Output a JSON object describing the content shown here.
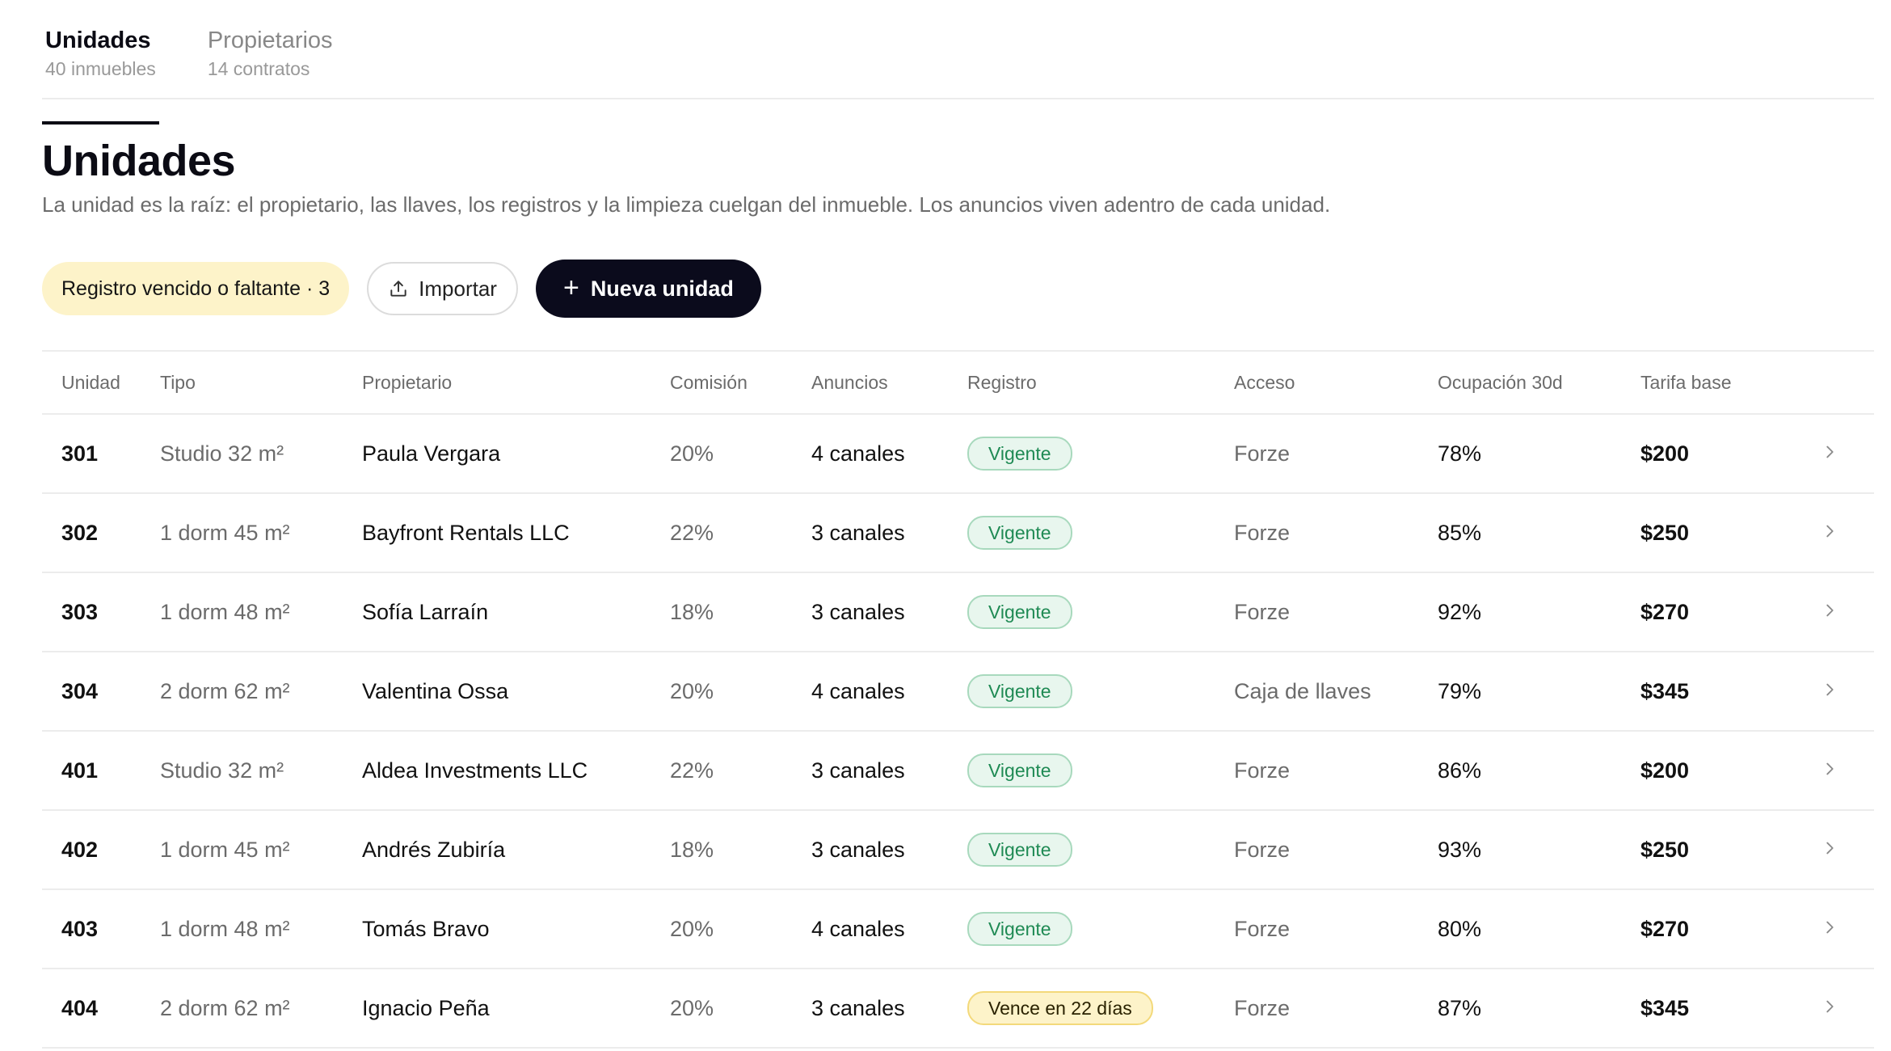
{
  "tabs": [
    {
      "label": "Unidades",
      "sub": "40 inmuebles"
    },
    {
      "label": "Propietarios",
      "sub": "14 contratos"
    }
  ],
  "header": {
    "title": "Unidades",
    "description": "La unidad es la raíz: el propietario, las llaves, los registros y la limpieza cuelgan del inmueble. Los anuncios viven adentro de cada unidad."
  },
  "toolbar": {
    "filter_label": "Registro vencido o faltante · 3",
    "import_label": "Importar",
    "new_label": "Nueva unidad"
  },
  "table": {
    "columns": [
      "Unidad",
      "Tipo",
      "Propietario",
      "Comisión",
      "Anuncios",
      "Registro",
      "Acceso",
      "Ocupación 30d",
      "Tarifa base"
    ],
    "rows": [
      {
        "unidad": "301",
        "tipo": "Studio 32 m²",
        "propietario": "Paula Vergara",
        "comision": "20%",
        "anuncios": "4 canales",
        "registro": "Vigente",
        "registro_status": "ok",
        "acceso": "Forze",
        "ocupacion": "78%",
        "tarifa": "$200"
      },
      {
        "unidad": "302",
        "tipo": "1 dorm 45 m²",
        "propietario": "Bayfront Rentals LLC",
        "comision": "22%",
        "anuncios": "3 canales",
        "registro": "Vigente",
        "registro_status": "ok",
        "acceso": "Forze",
        "ocupacion": "85%",
        "tarifa": "$250"
      },
      {
        "unidad": "303",
        "tipo": "1 dorm 48 m²",
        "propietario": "Sofía Larraín",
        "comision": "18%",
        "anuncios": "3 canales",
        "registro": "Vigente",
        "registro_status": "ok",
        "acceso": "Forze",
        "ocupacion": "92%",
        "tarifa": "$270"
      },
      {
        "unidad": "304",
        "tipo": "2 dorm 62 m²",
        "propietario": "Valentina Ossa",
        "comision": "20%",
        "anuncios": "4 canales",
        "registro": "Vigente",
        "registro_status": "ok",
        "acceso": "Caja de llaves",
        "ocupacion": "79%",
        "tarifa": "$345"
      },
      {
        "unidad": "401",
        "tipo": "Studio 32 m²",
        "propietario": "Aldea Investments LLC",
        "comision": "22%",
        "anuncios": "3 canales",
        "registro": "Vigente",
        "registro_status": "ok",
        "acceso": "Forze",
        "ocupacion": "86%",
        "tarifa": "$200"
      },
      {
        "unidad": "402",
        "tipo": "1 dorm 45 m²",
        "propietario": "Andrés Zubiría",
        "comision": "18%",
        "anuncios": "3 canales",
        "registro": "Vigente",
        "registro_status": "ok",
        "acceso": "Forze",
        "ocupacion": "93%",
        "tarifa": "$250"
      },
      {
        "unidad": "403",
        "tipo": "1 dorm 48 m²",
        "propietario": "Tomás Bravo",
        "comision": "20%",
        "anuncios": "4 canales",
        "registro": "Vigente",
        "registro_status": "ok",
        "acceso": "Forze",
        "ocupacion": "80%",
        "tarifa": "$270"
      },
      {
        "unidad": "404",
        "tipo": "2 dorm 62 m²",
        "propietario": "Ignacio Peña",
        "comision": "20%",
        "anuncios": "3 canales",
        "registro": "Vence en 22 días",
        "registro_status": "warn",
        "acceso": "Forze",
        "ocupacion": "87%",
        "tarifa": "$345"
      }
    ]
  },
  "icons": {
    "import": "upload-icon",
    "new": "plus-icon",
    "row_open": "chevron-right-icon"
  },
  "colors": {
    "accent_dark": "#0b0b1c",
    "warning_bg": "#fdf3c9",
    "ok_bg": "#e8f6ee",
    "ok_text": "#1f8a54"
  }
}
